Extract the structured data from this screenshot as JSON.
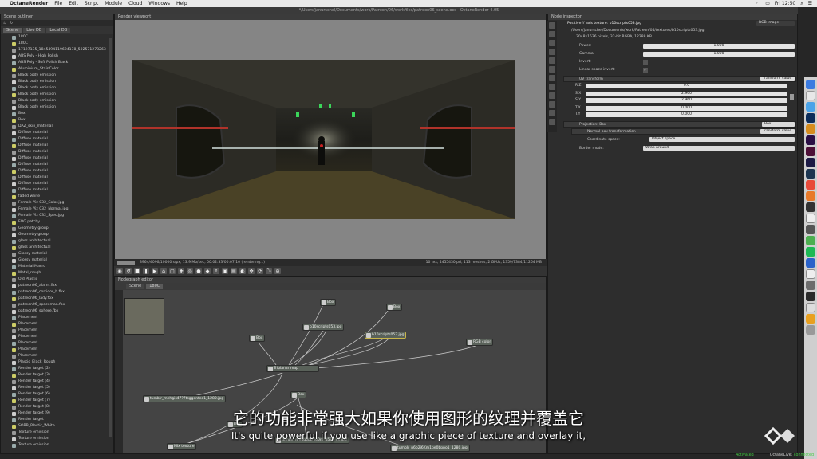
{
  "menubar": {
    "app": "OctaneRender",
    "items": [
      "File",
      "Edit",
      "Script",
      "Module",
      "Cloud",
      "Windows",
      "Help"
    ],
    "clock": "Fri 12:50"
  },
  "window_title": "*/Users/janurschel/Documents/work/Patreon/06/workfiles/patreon06_scene.ocs - OctaneRender 4.05",
  "outliner": {
    "title": "Scene outliner",
    "tabs": [
      "Scene",
      "Live DB",
      "Local DB"
    ],
    "items": [
      "180C",
      "180C",
      "17127135_1845494119624178_502571278263",
      "ABS Poly - High Polish",
      "ABS Poly - Soft Polish Black",
      "Aluminium_StainColor",
      "Black body emission",
      "Black body emission",
      "Black body emission",
      "Black body emission",
      "Black body emission",
      "Black body emission",
      "Box",
      "Box",
      "DAZ_skin_material",
      "Diffuse material",
      "Diffuse material",
      "Diffuse material",
      "Diffuse material",
      "Diffuse material",
      "Diffuse material",
      "Diffuse material",
      "Diffuse material",
      "Diffuse material",
      "Diffuse material",
      "faded white",
      "Female Viz 032_Color.jpg",
      "Female Viz 032_Normal.jpg",
      "Female Viz 032_Spec.jpg",
      "FOG patchy",
      "Geometry group",
      "Geometry group",
      "glass architectual",
      "glass architectual",
      "Glossy material",
      "Glossy material",
      "Material Macro",
      "Metal_rough",
      "Old Plastic",
      "patreon06_alarm.fbx",
      "patreon06_corridor_b.fbx",
      "patreon06_lady.fbx",
      "patreon06_spaceman.fbx",
      "patreon06_sphere.fbx",
      "Placement",
      "Placement",
      "Placement",
      "Placement",
      "Placement",
      "Placement",
      "Placement",
      "Plastic_Black_Rough",
      "Render target (2)",
      "Render target (3)",
      "Render target (4)",
      "Render target (5)",
      "Render target (6)",
      "Render target (7)",
      "Render target (8)",
      "Render target (9)",
      "Render target",
      "SOBB_Plastic_White",
      "Texture emission",
      "Texture emission",
      "Texture emission"
    ]
  },
  "viewport": {
    "title": "Render viewport",
    "status_left": "3964/4096/10000 s/px, 13.9 Mb/sec, 00:02:33/00:07:10 (rendering...)",
    "status_right": "10 tex, 4455430 pri, 113 meshes, 2 GPUs, 1359/7384/11264 MB"
  },
  "nodegraph": {
    "title": "Nodegraph editor",
    "tabs": [
      "Scene",
      "180C"
    ],
    "nodes": [
      "Box",
      "Box",
      "b10scripts053.jpg",
      "b10scripts053.jpg",
      "Box",
      "RGB color",
      "Triplanar map",
      "Box",
      "tumblr_mehgis47?7tsggenfeo1_1280.jpg",
      "Box",
      "Mix texture",
      "tumblr_nmbg6pp_lo0m_b5Ffl_4k.jpg",
      "tumblr_n6b2i6Km1pe0bppo1_1280.jpg"
    ]
  },
  "inspector": {
    "title": "Node inspector",
    "node_title": "Positive Y axis texture: b10scripts053.jpg",
    "node_type": "RGB image",
    "path": "/Users/janurschel/Documents/work/Patreon/04/textures/b10scripts053.jpg",
    "info": "2048x1536 pixels, 32-bit RGBA, 12288 KB",
    "power_label": "Power:",
    "power": "1.000",
    "gamma_label": "Gamma:",
    "gamma": "1.000",
    "invert_label": "Invert:",
    "linear_label": "Linear space invert:",
    "uv_label": "UV transform",
    "uv_type": "Transform value",
    "rz_label": "R.Z",
    "rz": "0.0",
    "sx_label": "S.X",
    "sx": "2.960",
    "sy_label": "S.Y",
    "sy": "2.960",
    "tx_label": "T.X",
    "tx": "0.000",
    "ty_label": "T.Y",
    "ty": "0.000",
    "proj_label": "Projection: Box",
    "proj_type": "Box",
    "nbt_label": "Normal box transformation",
    "nbt_type": "Transform value",
    "cs_label": "Coordinate space:",
    "cs": "Object space",
    "border_label": "Border mode:",
    "border": "Wrap around"
  },
  "subtitle": {
    "zh": "它的功能非常强大如果你使用图形的纹理并覆盖它",
    "en": "It's quite powerful if you use like a graphic piece of texture and overlay it,"
  },
  "bottom": {
    "activated": "Activated",
    "live": "OctaneLive:",
    "connected": "connected"
  }
}
